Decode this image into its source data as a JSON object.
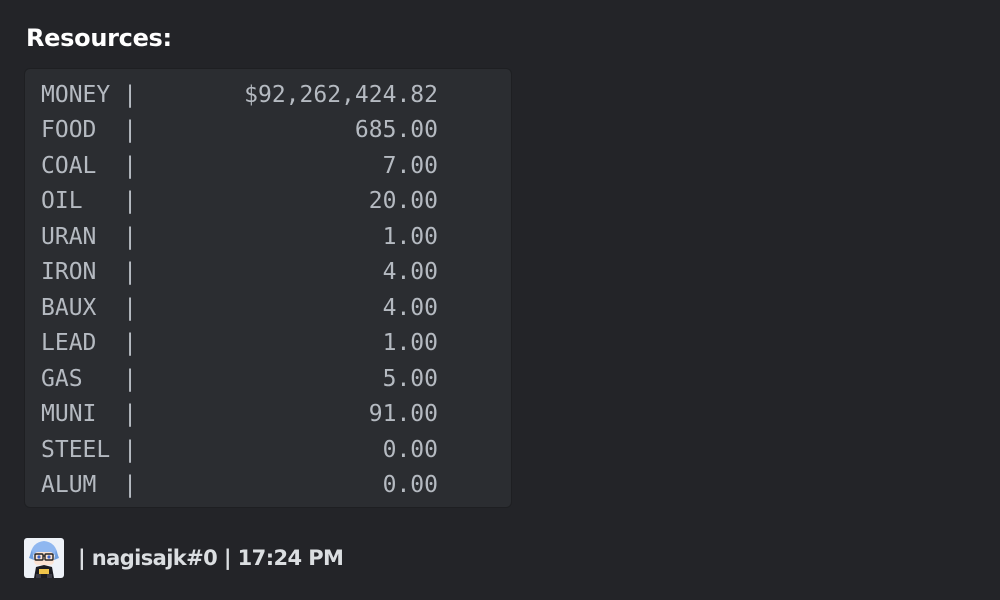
{
  "embed": {
    "title": "Resources:",
    "separator": "|",
    "resources": [
      {
        "name": "MONEY",
        "value": "$92,262,424.82"
      },
      {
        "name": "FOOD",
        "value": "685.00"
      },
      {
        "name": "COAL",
        "value": "7.00"
      },
      {
        "name": "OIL",
        "value": "20.00"
      },
      {
        "name": "URAN",
        "value": "1.00"
      },
      {
        "name": "IRON",
        "value": "4.00"
      },
      {
        "name": "BAUX",
        "value": "4.00"
      },
      {
        "name": "LEAD",
        "value": "1.00"
      },
      {
        "name": "GAS",
        "value": "5.00"
      },
      {
        "name": "MUNI",
        "value": "91.00"
      },
      {
        "name": "STEEL",
        "value": "0.00"
      },
      {
        "name": "ALUM",
        "value": "0.00"
      }
    ],
    "footer": {
      "text": "| nagisajk#0 | 17:24 PM",
      "avatar_icon": "anime-avatar-icon"
    }
  },
  "colors": {
    "background": "#232428",
    "code_block": "#2b2d31",
    "code_text": "#b5bac1",
    "title_text": "#ffffff",
    "footer_text": "#dbdee1"
  }
}
